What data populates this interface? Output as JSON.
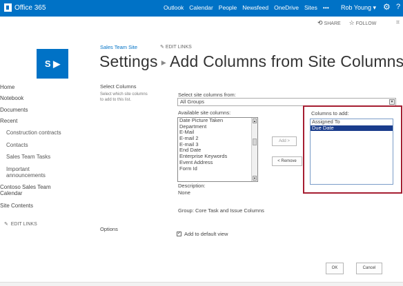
{
  "suitebar": {
    "brand": "Office 365",
    "nav": [
      "Outlook",
      "Calendar",
      "People",
      "Newsfeed",
      "OneDrive",
      "Sites",
      "•••"
    ],
    "user": "Rob Young ▾",
    "gear_icon": "gear-icon",
    "help_icon": "help-icon",
    "help_glyph": "?"
  },
  "actionbar": {
    "share": "SHARE",
    "follow": "FOLLOW"
  },
  "logo": {
    "text": "S ▶"
  },
  "title": {
    "site": "Sales Team Site",
    "edit_links": "EDIT LINKS",
    "part1": "Settings",
    "part2": "Add Columns from Site Columns"
  },
  "leftnav": {
    "home": "Home",
    "notebook": "Notebook",
    "documents": "Documents",
    "recent": "Recent",
    "construction": "Construction contracts",
    "contacts": "Contacts",
    "tasks": "Sales Team Tasks",
    "important1": "Important",
    "important2": "announcements",
    "calendar1": "Contoso Sales Team",
    "calendar2": "Calendar",
    "site_contents": "Site Contents",
    "edit_links": "EDIT LINKS"
  },
  "form": {
    "select_columns_title": "Select Columns",
    "select_columns_desc1": "Select which site columns",
    "select_columns_desc2": "to add to this list.",
    "select_from_label": "Select site columns from:",
    "select_from_value": "All Groups",
    "available_label": "Available site columns:",
    "available_columns": [
      "Date Picture Taken",
      "Department",
      "E-Mail",
      "E-mail 2",
      "E-mail 3",
      "End Date",
      "Enterprise Keywords",
      "Event Address",
      "Form Id"
    ],
    "add_button": "Add >",
    "remove_button": "< Remove",
    "columns_to_add_label": "Columns to add:",
    "columns_to_add": [
      "Assigned To",
      "Due Date"
    ],
    "selected_column": "Due Date",
    "description_label": "Description:",
    "description_value": "None",
    "group_label": "Group: Core Task and Issue Columns",
    "options_title": "Options",
    "add_default_view": "Add to default view",
    "add_default_view_checked": true,
    "ok_button": "OK",
    "cancel_button": "Cancel"
  },
  "colors": {
    "suitebar": "#0072c6",
    "highlight_box": "#a51c30",
    "selection": "#1a3c8c"
  }
}
